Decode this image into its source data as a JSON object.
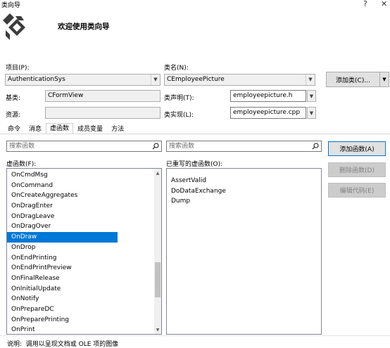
{
  "window": {
    "title": "类向导",
    "help_label": "?",
    "close_label": "✕"
  },
  "header": {
    "welcome": "欢迎使用类向导"
  },
  "project": {
    "label": "项目(P):",
    "value": "AuthenticationSys"
  },
  "classname": {
    "label": "类名(N):",
    "value": "CEmployeePicture"
  },
  "add_class_button": {
    "label": "添加类(C)...",
    "arrow": "▼"
  },
  "base_class": {
    "label": "基类:",
    "value": "CFormView"
  },
  "resource": {
    "label": "资源:",
    "value": ""
  },
  "class_decl": {
    "label": "类声明(T):",
    "value": "employeepicture.h"
  },
  "class_impl": {
    "label": "类实现(L):",
    "value": "employeepicture.cpp"
  },
  "tabs": [
    "命令",
    "消息",
    "虚函数",
    "成员变量",
    "方法"
  ],
  "active_tab": "虚函数",
  "left_search": {
    "placeholder": "搜索函数"
  },
  "right_search": {
    "placeholder": "搜索函数"
  },
  "virtual_functions": {
    "label": "虚函数(F):",
    "items": [
      "OnCmdMsg",
      "OnCommand",
      "OnCreateAggregates",
      "OnDragEnter",
      "OnDragLeave",
      "OnDragOver",
      "OnDraw",
      "OnDrop",
      "OnEndPrinting",
      "OnEndPrintPreview",
      "OnFinalRelease",
      "OnInitialUpdate",
      "OnNotify",
      "OnPrepareDC",
      "OnPreparePrinting",
      "OnPrint"
    ],
    "selected": "OnDraw"
  },
  "overridden_functions": {
    "label": "已重写的虚函数(O):",
    "items": [
      "AssertValid",
      "DoDataExchange",
      "Dump"
    ]
  },
  "buttons": {
    "add_function": "添加函数(A)",
    "delete_function": "删除函数(D)",
    "edit_code": "编辑代码(E)"
  },
  "status": {
    "label": "说明:",
    "text": "调用以呈现文档或 OLE 项的图像"
  },
  "icons": {
    "search": "search-icon",
    "logo": "class-wizard-logo-icon"
  }
}
